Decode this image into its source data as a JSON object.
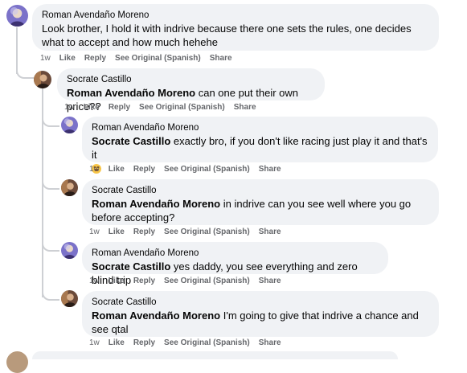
{
  "actions": {
    "time": "1w",
    "like": "Like",
    "reply": "Reply",
    "see_original": "See Original (Spanish)",
    "share": "Share"
  },
  "comments": [
    {
      "author": "Roman Avendaño Moreno",
      "mention": "",
      "text": "Look brother, I hold it with indrive because there one sets the rules, one decides what to accept and how much hehehe"
    },
    {
      "author": "Socrate Castillo",
      "mention": "Roman Avendaño Moreno",
      "text": " can one put their own price??"
    },
    {
      "author": "Roman Avendaño Moreno",
      "mention": "Socrate Castillo",
      "text": " exactly bro, if you don't like racing just play it and that's it",
      "emoji": "grinning-face"
    },
    {
      "author": "Socrate Castillo",
      "mention": "Roman Avendaño Moreno",
      "text": " in indrive can you see well where you go before accepting?"
    },
    {
      "author": "Roman Avendaño Moreno",
      "mention": "Socrate Castillo",
      "text": " yes daddy, you see everything and zero blind trip"
    },
    {
      "author": "Socrate Castillo",
      "mention": "Roman Avendaño Moreno",
      "text": " I'm going to give that indrive a chance and see qtal"
    }
  ],
  "colors": {
    "bubble": "#f0f2f5",
    "meta": "#65676b",
    "thread": "#ced0d4",
    "roman_avatar": "#7b72c9",
    "socrate_avatar": "#6b4a3a"
  }
}
